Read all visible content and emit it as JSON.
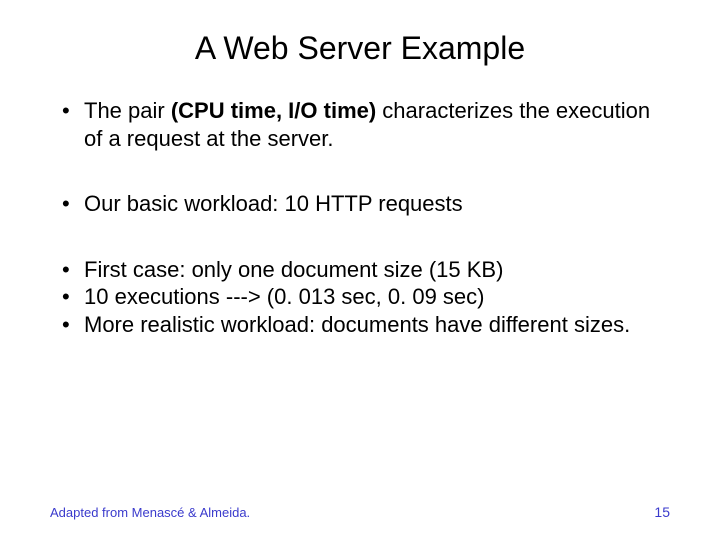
{
  "title": "A Web Server Example",
  "bullets": {
    "b1_pre": "The pair ",
    "b1_bold": "(CPU time, I/O time)",
    "b1_post": " characterizes the execution of a request at the server.",
    "b2": "Our basic workload: 10 HTTP requests",
    "b3": "First case: only one document size (15 KB)",
    "b4": "10 executions ---> (0. 013 sec, 0. 09 sec)",
    "b5": "More realistic workload: documents have different sizes."
  },
  "footer": {
    "left": "Adapted from Menascé & Almeida.",
    "page": "15"
  }
}
